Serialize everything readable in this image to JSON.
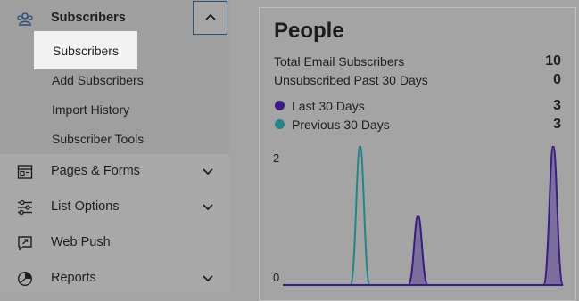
{
  "sidebar": {
    "subscribers_header": {
      "label": "Subscribers",
      "icon": "subscribers-icon"
    },
    "collapse_icon": "chevron-up-icon",
    "sub_items": [
      {
        "label": "Subscribers",
        "active": true
      },
      {
        "label": "Add Subscribers"
      },
      {
        "label": "Import History"
      },
      {
        "label": "Subscriber Tools"
      }
    ],
    "items": [
      {
        "label": "Pages & Forms",
        "icon": "pages-forms-icon",
        "has_chevron": true
      },
      {
        "label": "List Options",
        "icon": "sliders-icon",
        "has_chevron": true
      },
      {
        "label": "Web Push",
        "icon": "web-push-icon",
        "has_chevron": false
      },
      {
        "label": "Reports",
        "icon": "pie-chart-icon",
        "has_chevron": true
      }
    ]
  },
  "card": {
    "title": "People",
    "stats": [
      {
        "label": "Total Email Subscribers",
        "value": "10"
      },
      {
        "label": "Unsubscribed Past 30 Days",
        "value": "0"
      }
    ],
    "legend": [
      {
        "label": "Last 30 Days",
        "value": "3",
        "color": "#3b1c80"
      },
      {
        "label": "Previous 30 Days",
        "value": "3",
        "color": "#23858a"
      }
    ]
  },
  "chart_data": {
    "type": "area",
    "ylim": [
      0,
      2
    ],
    "y_ticks": [
      "2",
      "0"
    ],
    "series": [
      {
        "name": "Previous 30 Days",
        "peaks": [
          {
            "day": 8,
            "value": 2.2
          }
        ]
      },
      {
        "name": "Last 30 Days",
        "peaks": [
          {
            "day": 14,
            "value": 1.1
          },
          {
            "day": 28,
            "value": 2.2
          }
        ]
      }
    ],
    "x_days": 30
  },
  "colors": {
    "accent": "#2d4f7c",
    "last_30": "#3b1c80",
    "previous_30": "#23858a",
    "area_fill": "#7d6f9d"
  }
}
